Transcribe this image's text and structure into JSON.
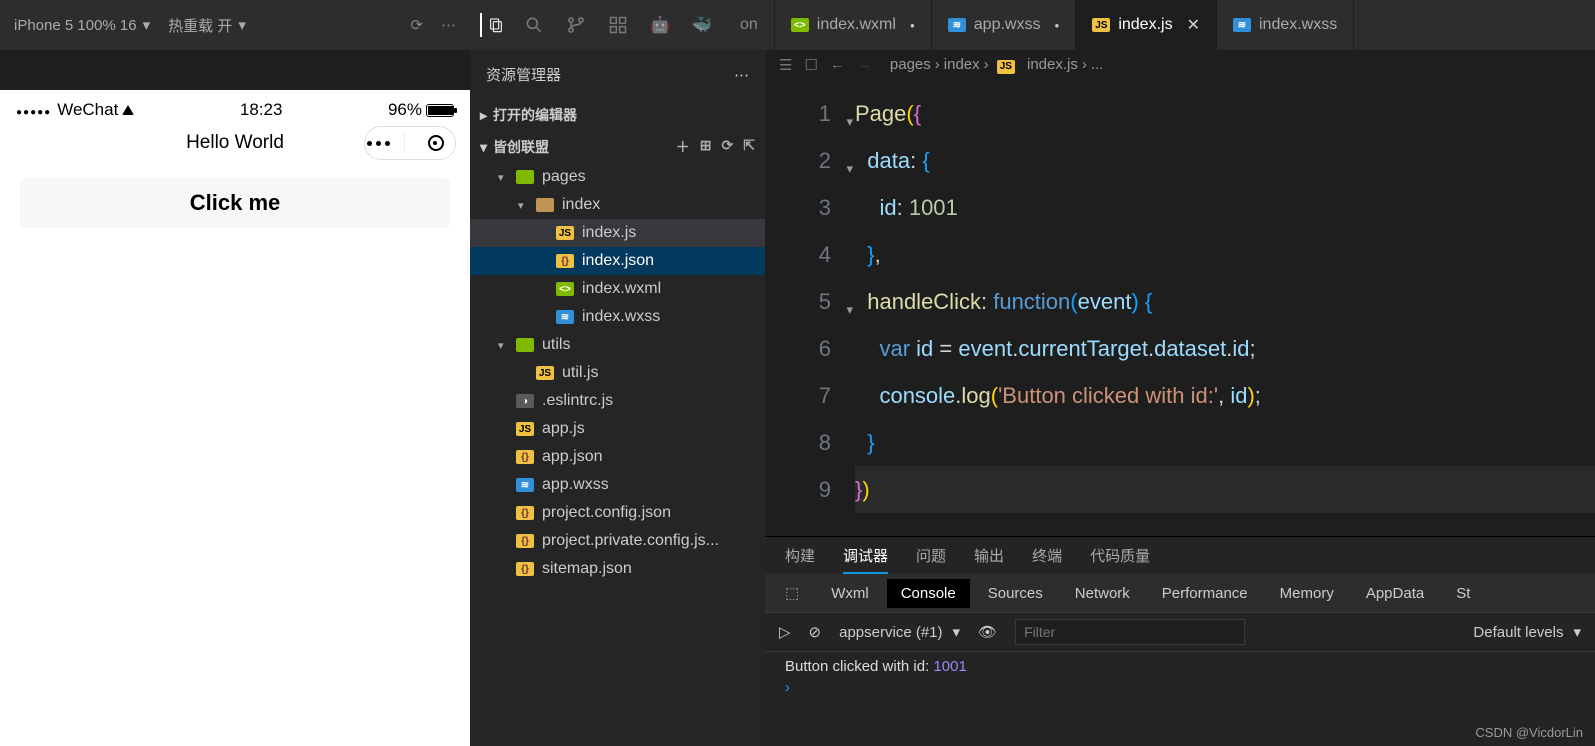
{
  "topbar": {
    "device": "iPhone 5 100% 16",
    "hotreload": "热重载 开",
    "tabs": [
      {
        "icon": "wxml",
        "label": "index.wxml",
        "state": "mod"
      },
      {
        "icon": "wxss",
        "label": "app.wxss",
        "state": "mod"
      },
      {
        "icon": "js",
        "label": "index.js",
        "state": "active"
      },
      {
        "icon": "wxss",
        "label": "index.wxss",
        "state": ""
      }
    ],
    "extra_tab": "on"
  },
  "simulator": {
    "carrier": "WeChat",
    "time": "18:23",
    "battery": "96%",
    "page_title": "Hello World",
    "button_label": "Click me"
  },
  "explorer": {
    "title": "资源管理器",
    "open_editors": "打开的编辑器",
    "project": "皆创联盟",
    "tree": [
      {
        "type": "folder",
        "label": "pages",
        "open": true,
        "depth": 1,
        "icon": "green"
      },
      {
        "type": "folder",
        "label": "index",
        "open": true,
        "depth": 2,
        "icon": "plain"
      },
      {
        "type": "file",
        "label": "index.js",
        "depth": 3,
        "fi": "js",
        "sel": "sel"
      },
      {
        "type": "file",
        "label": "index.json",
        "depth": 3,
        "fi": "json",
        "sel": "sel2"
      },
      {
        "type": "file",
        "label": "index.wxml",
        "depth": 3,
        "fi": "wxml"
      },
      {
        "type": "file",
        "label": "index.wxss",
        "depth": 3,
        "fi": "wxss"
      },
      {
        "type": "folder",
        "label": "utils",
        "open": true,
        "depth": 1,
        "icon": "green"
      },
      {
        "type": "file",
        "label": "util.js",
        "depth": 2,
        "fi": "js"
      },
      {
        "type": "file",
        "label": ".eslintrc.js",
        "depth": 1,
        "fi": "cfg"
      },
      {
        "type": "file",
        "label": "app.js",
        "depth": 1,
        "fi": "js"
      },
      {
        "type": "file",
        "label": "app.json",
        "depth": 1,
        "fi": "json"
      },
      {
        "type": "file",
        "label": "app.wxss",
        "depth": 1,
        "fi": "wxss"
      },
      {
        "type": "file",
        "label": "project.config.json",
        "depth": 1,
        "fi": "json"
      },
      {
        "type": "file",
        "label": "project.private.config.js...",
        "depth": 1,
        "fi": "json"
      },
      {
        "type": "file",
        "label": "sitemap.json",
        "depth": 1,
        "fi": "json"
      }
    ]
  },
  "breadcrumb": {
    "parts": [
      "pages",
      "index",
      "index.js",
      "..."
    ]
  },
  "code": {
    "lines": [
      {
        "n": 1,
        "fold": "▾",
        "html": "<span class='tk-fn'>Page</span><span class='tk-br'>(</span><span class='tk-br2'>{</span>"
      },
      {
        "n": 2,
        "fold": "▾",
        "html": "  <span class='tk-id'>data</span><span class='tk-pl'>:</span> <span class='tk-br3'>{</span>"
      },
      {
        "n": 3,
        "html": "    <span class='tk-id'>id</span><span class='tk-pl'>:</span> <span class='tk-num'>1001</span>"
      },
      {
        "n": 4,
        "html": "  <span class='tk-br3'>}</span><span class='tk-pl'>,</span>"
      },
      {
        "n": 5,
        "fold": "▾",
        "html": "  <span class='tk-fn'>handleClick</span><span class='tk-pl'>:</span> <span class='tk-kw'>function</span><span class='tk-br3'>(</span><span class='tk-id'>event</span><span class='tk-br3'>)</span> <span class='tk-br3'>{</span>"
      },
      {
        "n": 6,
        "html": "    <span class='tk-kw'>var</span> <span class='tk-id'>id</span> <span class='tk-pl'>=</span> <span class='tk-id'>event</span><span class='tk-pl'>.</span><span class='tk-id'>currentTarget</span><span class='tk-pl'>.</span><span class='tk-id'>dataset</span><span class='tk-pl'>.</span><span class='tk-id'>id</span><span class='tk-pl'>;</span>"
      },
      {
        "n": 7,
        "html": "    <span class='tk-id'>console</span><span class='tk-pl'>.</span><span class='tk-fn'>log</span><span class='tk-br'>(</span><span class='tk-str'>'Button clicked with id:'</span><span class='tk-pl'>,</span> <span class='tk-id'>id</span><span class='tk-br'>)</span><span class='tk-pl'>;</span>"
      },
      {
        "n": 8,
        "html": "  <span class='tk-br3'>}</span>"
      },
      {
        "n": 9,
        "active": true,
        "html": "<span class='tk-br2'>}</span><span class='tk-br'>)</span>"
      }
    ]
  },
  "devtools": {
    "tabs1": [
      "构建",
      "调试器",
      "问题",
      "输出",
      "终端",
      "代码质量"
    ],
    "tabs1_active": 1,
    "tabs2": [
      "Wxml",
      "Console",
      "Sources",
      "Network",
      "Performance",
      "Memory",
      "AppData",
      "St"
    ],
    "tabs2_active": 1,
    "context": "appservice (#1)",
    "filter_placeholder": "Filter",
    "levels": "Default levels",
    "log_text": "Button clicked with id:",
    "log_val": "1001"
  },
  "watermark": "CSDN @VicdorLin"
}
